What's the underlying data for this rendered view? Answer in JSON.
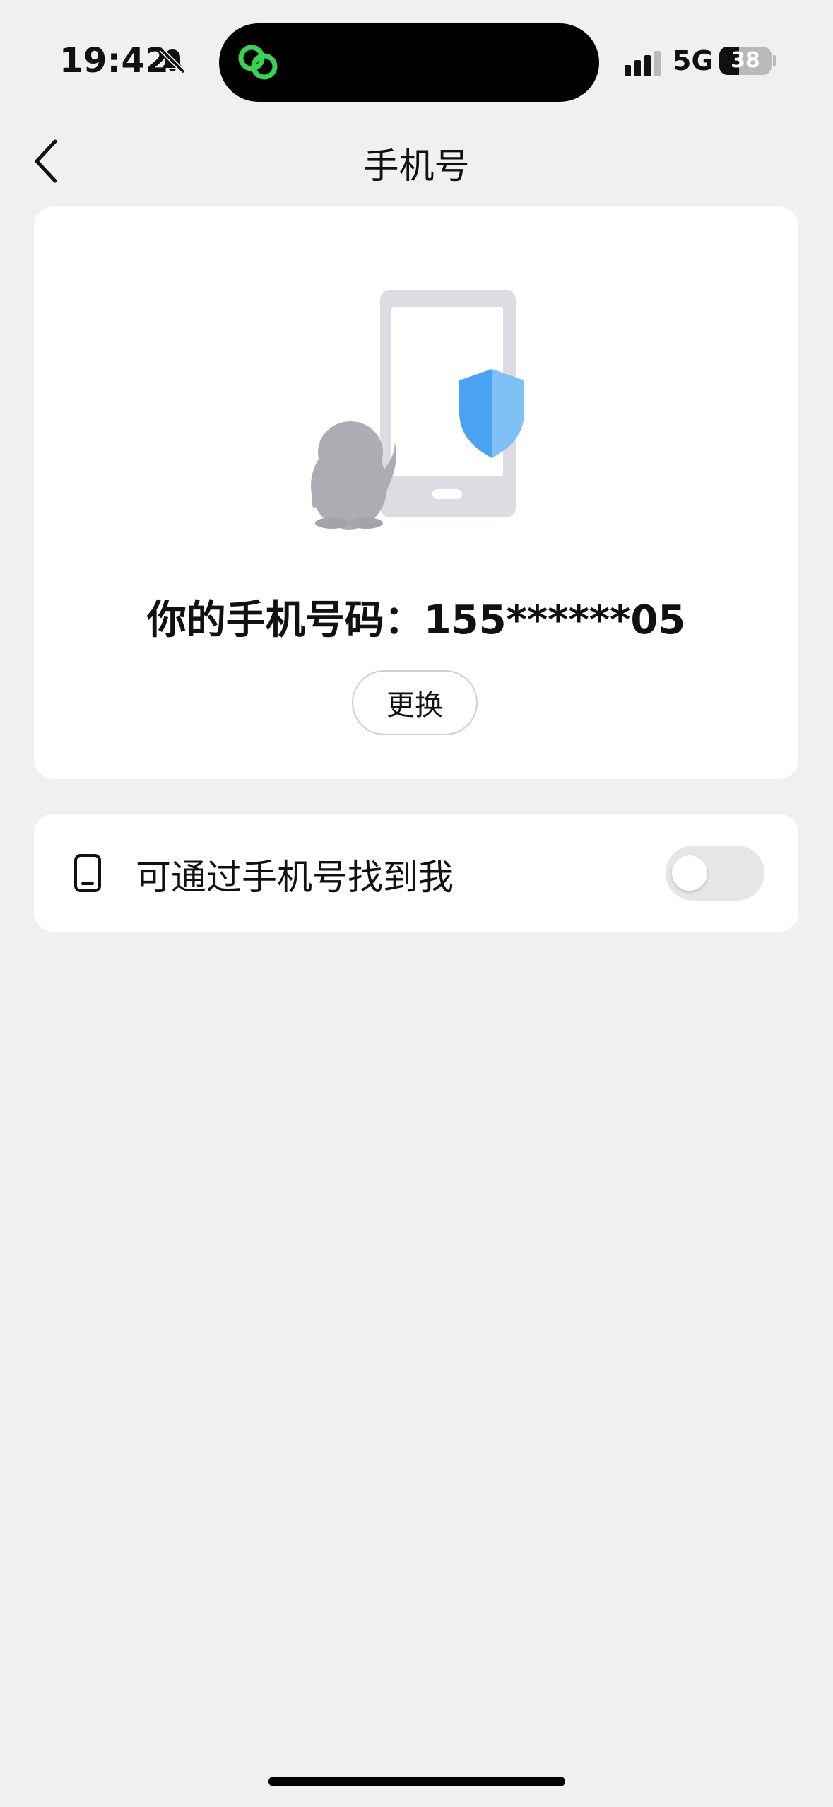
{
  "status_bar": {
    "time": "19:42",
    "network": "5G",
    "battery_level": "38",
    "battery_fraction": 0.38,
    "icons": [
      "bell-slash-icon",
      "linked-rings-app-icon",
      "cellular-signal-icon",
      "battery-icon"
    ],
    "accent_app_color": "#39d353"
  },
  "nav": {
    "back_icon": "chevron-left-icon",
    "title": "手机号"
  },
  "phone_card": {
    "illustration_icons": [
      "phone-outline",
      "penguin-mascot",
      "security-shield"
    ],
    "phone_text": "你的手机号码：155******05",
    "change_button": "更换"
  },
  "find_card": {
    "icon": "phone-outline-icon",
    "label": "可通过手机号找到我",
    "toggle_on": false
  },
  "colors": {
    "background": "#f0f0f0",
    "card": "#ffffff",
    "shield_blue": "#4aa3f2",
    "illustration_gray": "#dcdde2",
    "toggle_off": "#e6e6e6"
  }
}
